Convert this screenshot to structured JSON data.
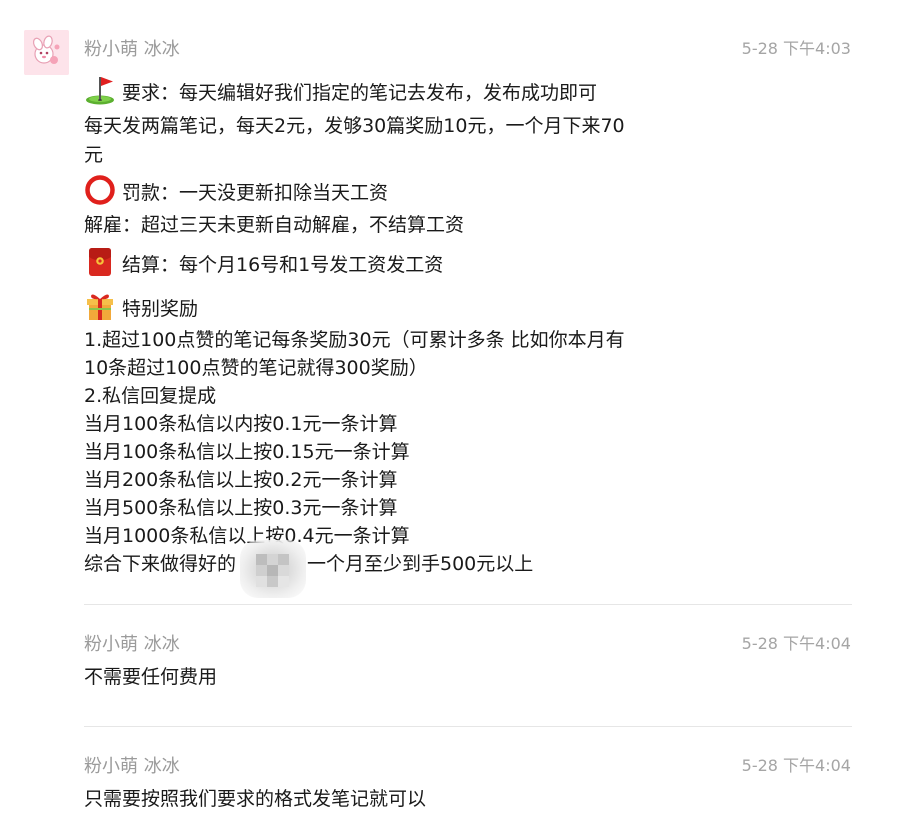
{
  "messages": [
    {
      "sender": "粉小萌 冰冰",
      "time": "5-28 下午4:03",
      "lines": [
        "要求：每天编辑好我们指定的笔记去发布，发布成功即可",
        "每天发两篇笔记，每天2元，发够30篇奖励10元，一个月下来70",
        "元",
        "罚款：一天没更新扣除当天工资",
        "解雇：超过三天未更新自动解雇，不结算工资",
        "结算：每个月16号和1号发工资发工资",
        "特别奖励",
        "1.超过100点赞的笔记每条奖励30元（可累计多条  比如你本月有",
        "10条超过100点赞的笔记就得300奖励）",
        "2.私信回复提成",
        "当月100条私信以内按0.1元一条计算",
        "当月100条私信以上按0.15元一条计算",
        "当月200条私信以上按0.2元一条计算",
        "当月500条私信以上按0.3元一条计算",
        "当月1000条私信以上按0.4元一条计算",
        "综合下来做得好的",
        "一个月至少到手500元以上"
      ]
    },
    {
      "sender": "粉小萌 冰冰",
      "time": "5-28 下午4:04",
      "lines": [
        "不需要任何费用"
      ]
    },
    {
      "sender": "粉小萌 冰冰",
      "time": "5-28 下午4:04",
      "lines": [
        "只需要按照我们要求的格式发笔记就可以"
      ]
    }
  ],
  "icons": {
    "avatar": "pink-cartoon-avatar",
    "line_0": "golf-flag-icon",
    "line_3": "red-circle-icon",
    "line_5": "red-envelope-icon",
    "line_6": "gift-box-icon"
  },
  "colors": {
    "sender": "#9b9b9b",
    "time": "#a5a5a5",
    "text": "#1a1a1a",
    "divider": "#e6e6e6"
  }
}
